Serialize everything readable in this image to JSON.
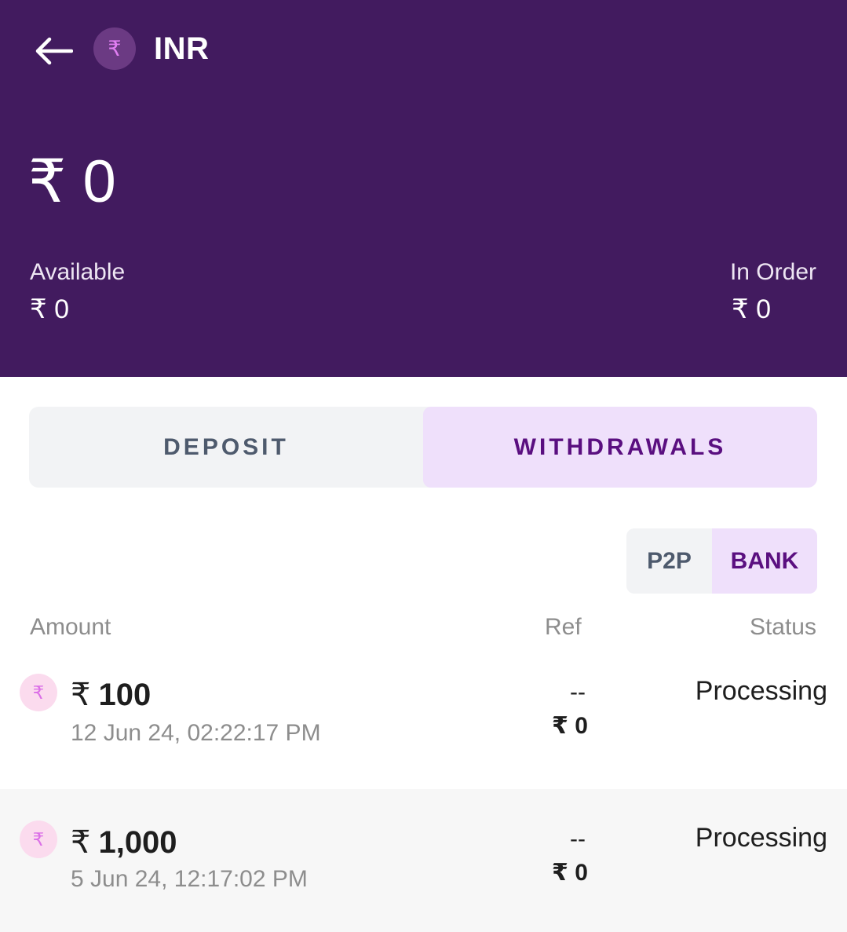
{
  "header": {
    "currency_symbol": "₹",
    "currency_code": "INR",
    "total_balance": "₹ 0",
    "available_label": "Available",
    "available_value": "₹ 0",
    "in_order_label": "In Order",
    "in_order_value": "₹ 0"
  },
  "tabs": [
    {
      "label": "DEPOSIT",
      "active": false
    },
    {
      "label": "WITHDRAWALS",
      "active": true
    }
  ],
  "subtabs": [
    {
      "label": "P2P",
      "active": false
    },
    {
      "label": "BANK",
      "active": true
    }
  ],
  "table": {
    "columns": [
      "Amount",
      "Ref",
      "Status"
    ],
    "rows": [
      {
        "icon": "₹",
        "currency": "₹",
        "amount": "100",
        "date": "12 Jun 24, 02:22:17 PM",
        "ref": "--",
        "ref_amount": "₹ 0",
        "status": "Processing"
      },
      {
        "icon": "₹",
        "currency": "₹",
        "amount": "1,000",
        "date": "5 Jun 24, 12:17:02 PM",
        "ref": "--",
        "ref_amount": "₹ 0",
        "status": "Processing"
      }
    ]
  },
  "colors": {
    "header_bg": "#421b5f",
    "accent": "#5a0f80",
    "active_tab_bg": "#efe0fb"
  }
}
